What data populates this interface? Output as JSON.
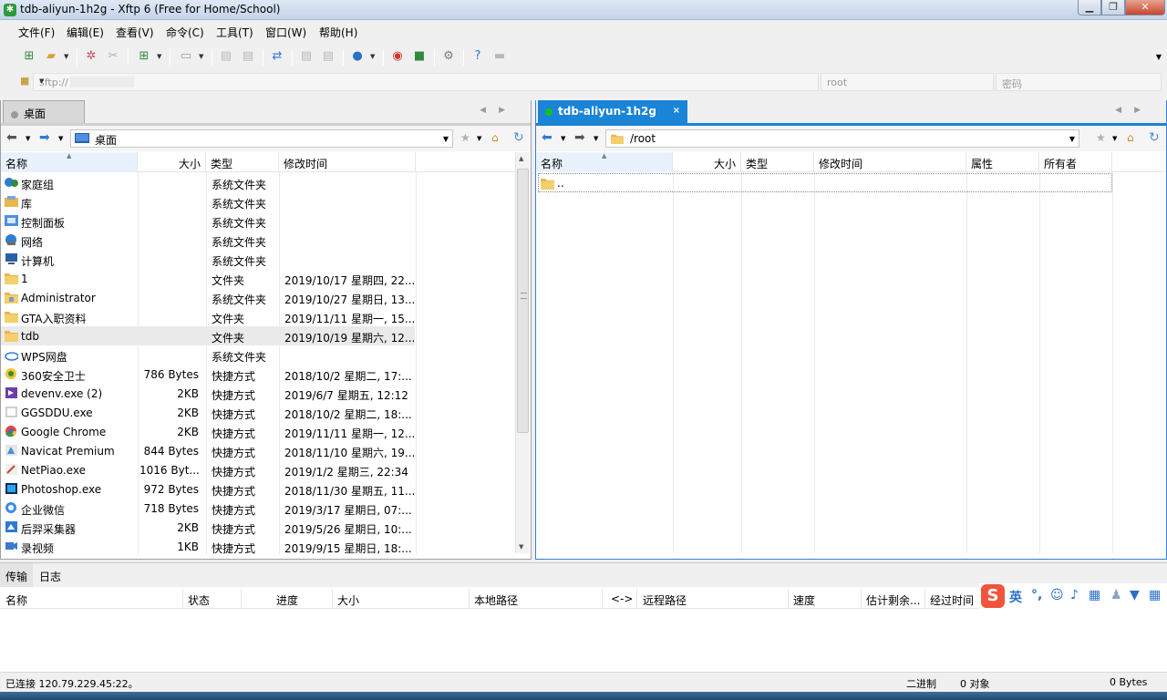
{
  "window": {
    "title": "tdb-aliyun-1h2g - Xftp 6 (Free for Home/School)",
    "app_icon_glyph": "✱"
  },
  "menu": [
    "文件(F)",
    "编辑(E)",
    "查看(V)",
    "命令(C)",
    "工具(T)",
    "窗口(W)",
    "帮助(H)"
  ],
  "address": {
    "url_prefix": "sftp://",
    "user_placeholder": "root",
    "password_placeholder": "密码"
  },
  "left_pane": {
    "tab_label": "桌面",
    "path": "桌面",
    "columns": [
      "名称",
      "大小",
      "类型",
      "修改时间"
    ],
    "rows": [
      {
        "name": "家庭组",
        "size": "",
        "type": "系统文件夹",
        "modified": "",
        "icon": "homegroup-icon"
      },
      {
        "name": "库",
        "size": "",
        "type": "系统文件夹",
        "modified": "",
        "icon": "library-icon"
      },
      {
        "name": "控制面板",
        "size": "",
        "type": "系统文件夹",
        "modified": "",
        "icon": "control-panel-icon"
      },
      {
        "name": "网络",
        "size": "",
        "type": "系统文件夹",
        "modified": "",
        "icon": "network-icon"
      },
      {
        "name": "计算机",
        "size": "",
        "type": "系统文件夹",
        "modified": "",
        "icon": "computer-icon"
      },
      {
        "name": "1",
        "size": "",
        "type": "文件夹",
        "modified": "2019/10/17 星期四, 22...",
        "icon": "folder-icon"
      },
      {
        "name": "Administrator",
        "size": "",
        "type": "系统文件夹",
        "modified": "2019/10/27 星期日, 13...",
        "icon": "user-folder-icon"
      },
      {
        "name": "GTA入职资料",
        "size": "",
        "type": "文件夹",
        "modified": "2019/11/11 星期一, 15...",
        "icon": "folder-icon"
      },
      {
        "name": "tdb",
        "size": "",
        "type": "文件夹",
        "modified": "2019/10/19 星期六, 12...",
        "icon": "folder-icon"
      },
      {
        "name": "WPS网盘",
        "size": "",
        "type": "系统文件夹",
        "modified": "",
        "icon": "cloud-icon"
      },
      {
        "name": "360安全卫士",
        "size": "786 Bytes",
        "type": "快捷方式",
        "modified": "2018/10/2 星期二, 17:...",
        "icon": "shortcut-360-icon"
      },
      {
        "name": "devenv.exe (2)",
        "size": "2KB",
        "type": "快捷方式",
        "modified": "2019/6/7 星期五, 12:12",
        "icon": "visual-studio-icon"
      },
      {
        "name": "GGSDDU.exe",
        "size": "2KB",
        "type": "快捷方式",
        "modified": "2018/10/2 星期二, 18:...",
        "icon": "app-shortcut-icon"
      },
      {
        "name": "Google Chrome",
        "size": "2KB",
        "type": "快捷方式",
        "modified": "2019/11/11 星期一, 12...",
        "icon": "chrome-icon"
      },
      {
        "name": "Navicat Premium",
        "size": "844 Bytes",
        "type": "快捷方式",
        "modified": "2018/11/10 星期六, 19...",
        "icon": "navicat-icon"
      },
      {
        "name": "NetPiao.exe",
        "size": "1016 Byt...",
        "type": "快捷方式",
        "modified": "2019/1/2 星期三, 22:34",
        "icon": "netpiao-icon"
      },
      {
        "name": "Photoshop.exe",
        "size": "972 Bytes",
        "type": "快捷方式",
        "modified": "2018/11/30 星期五, 11...",
        "icon": "photoshop-icon"
      },
      {
        "name": "企业微信",
        "size": "718 Bytes",
        "type": "快捷方式",
        "modified": "2019/3/17 星期日, 07:...",
        "icon": "wecom-icon"
      },
      {
        "name": "后羿采集器",
        "size": "2KB",
        "type": "快捷方式",
        "modified": "2019/5/26 星期日, 10:...",
        "icon": "collector-icon"
      },
      {
        "name": "录视频",
        "size": "1KB",
        "type": "快捷方式",
        "modified": "2019/9/15 星期日, 18:...",
        "icon": "recorder-icon"
      }
    ]
  },
  "right_pane": {
    "tab_label": "tdb-aliyun-1h2g",
    "tab_close": "×",
    "path": "/root",
    "columns": [
      "名称",
      "大小",
      "类型",
      "修改时间",
      "属性",
      "所有者"
    ],
    "parent_entry": ".."
  },
  "bottom": {
    "tabs": [
      "传输",
      "日志"
    ],
    "columns": [
      "名称",
      "状态",
      "进度",
      "大小",
      "本地路径",
      "<->",
      "远程路径",
      "速度",
      "估计剩余...",
      "经过时间"
    ]
  },
  "ime": {
    "logo": "S",
    "lang": "英"
  },
  "status": {
    "connection": "已连接 120.79.229.45:22。",
    "mode": "二进制",
    "objects": "0 对象",
    "bytes": "0 Bytes"
  },
  "colors": {
    "accent": "#1a84d6",
    "folder": "#e8b84a",
    "session_dot": "#17c21b"
  }
}
